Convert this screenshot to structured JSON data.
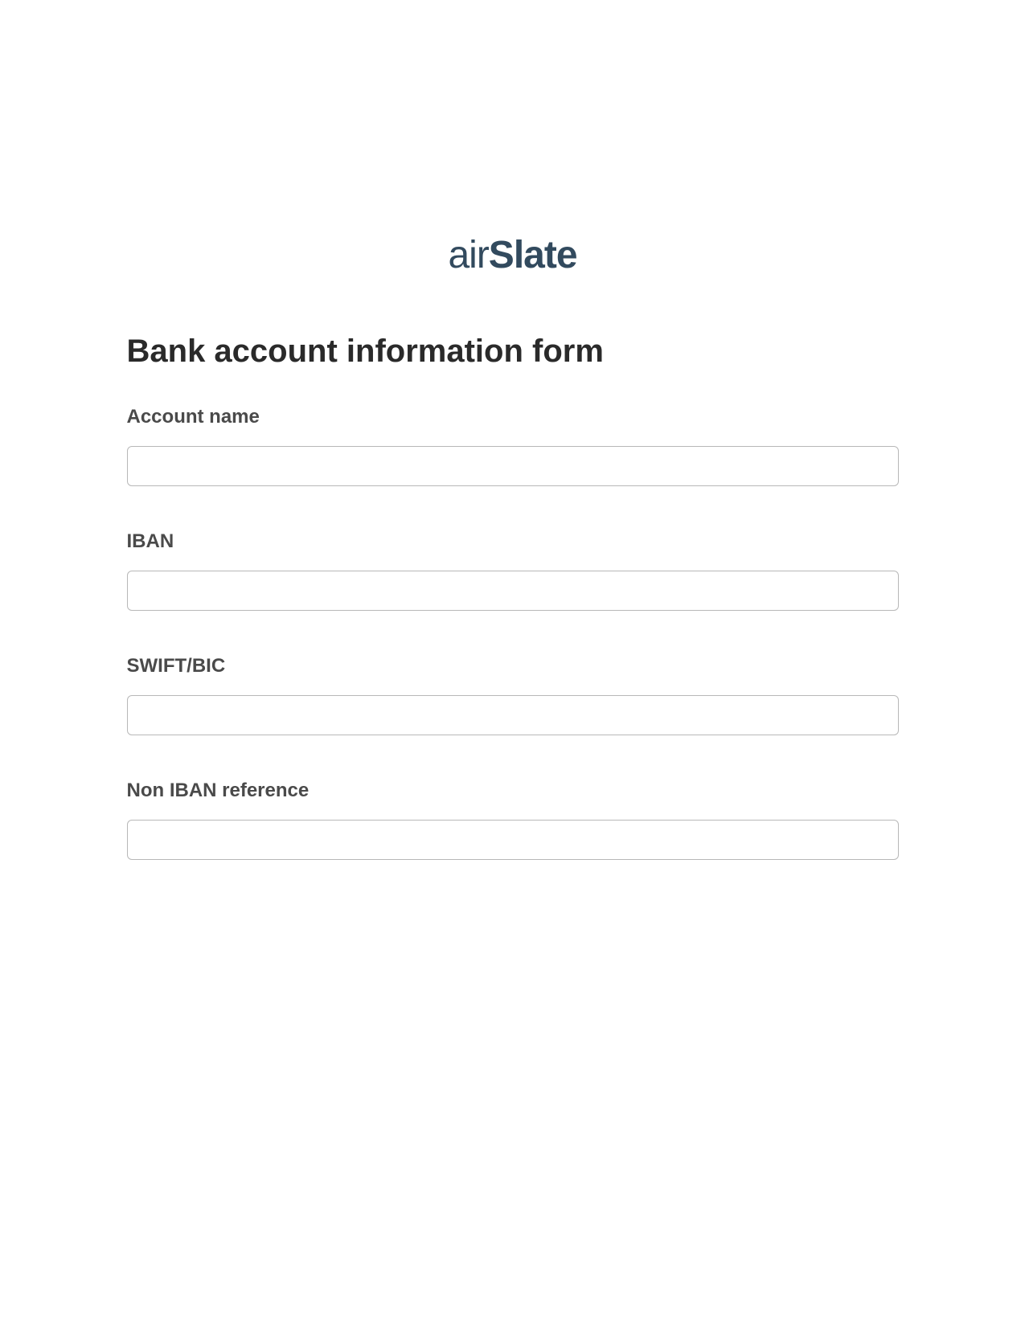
{
  "logo": {
    "prefix": "air",
    "suffix": "Slate"
  },
  "form": {
    "title": "Bank account information form",
    "fields": [
      {
        "label": "Account name",
        "value": ""
      },
      {
        "label": "IBAN",
        "value": ""
      },
      {
        "label": "SWIFT/BIC",
        "value": ""
      },
      {
        "label": "Non IBAN reference",
        "value": ""
      }
    ]
  }
}
